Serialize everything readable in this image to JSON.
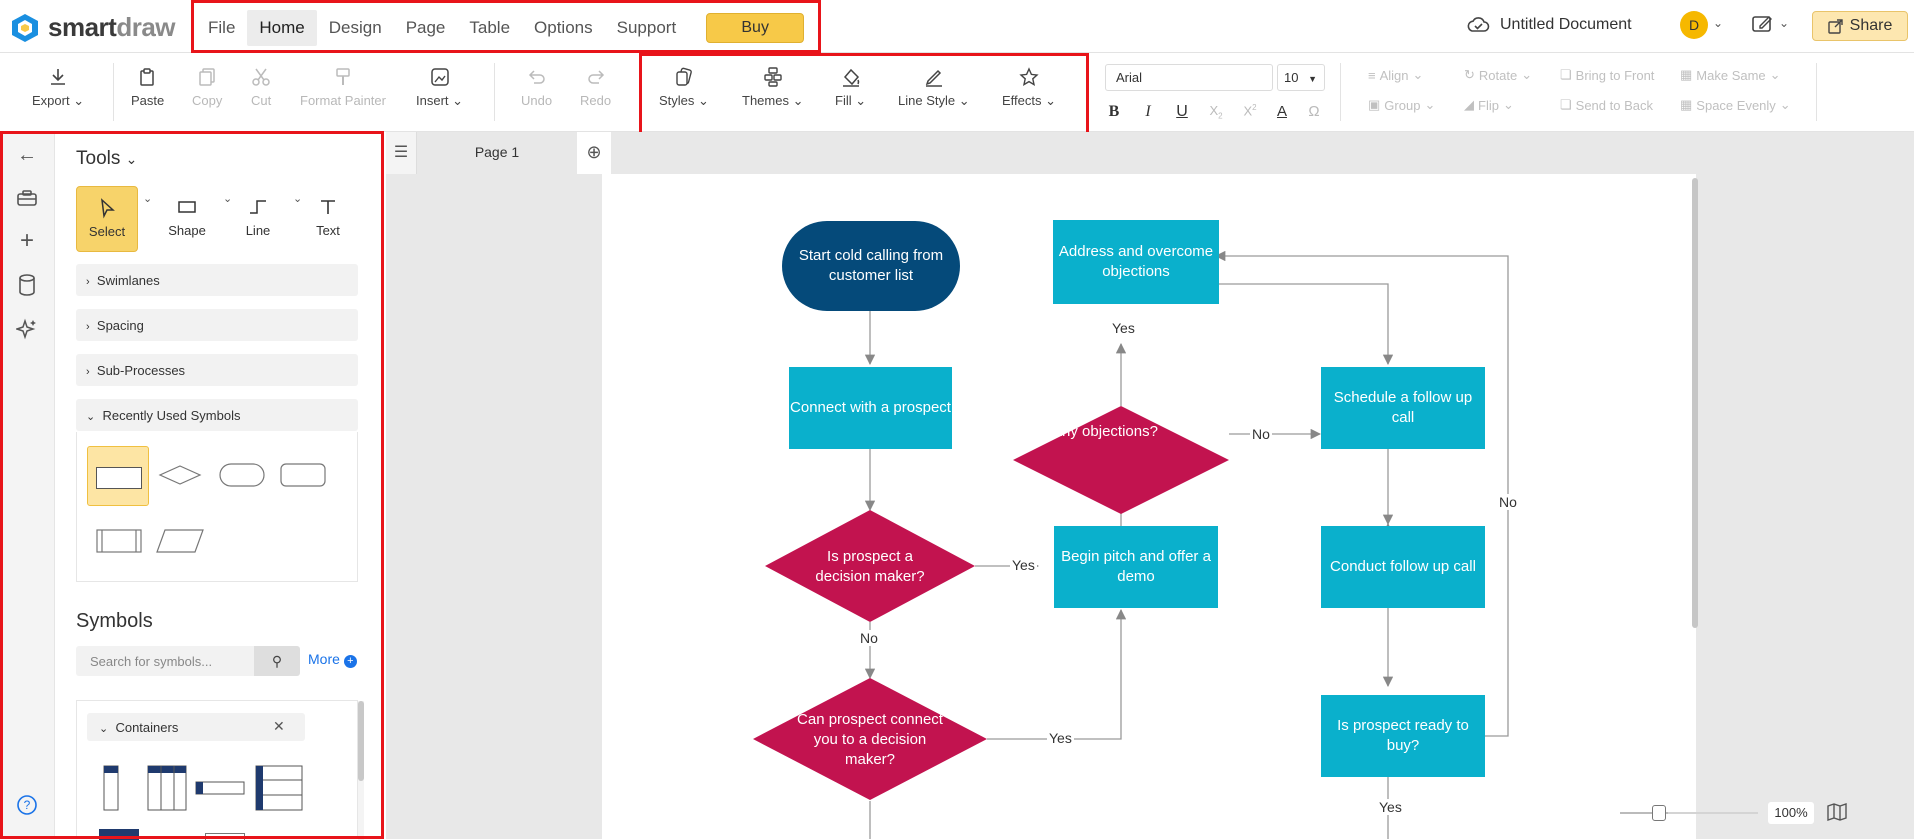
{
  "app": {
    "logo_main": "smart",
    "logo_accent": "draw"
  },
  "menu": [
    {
      "label": "File"
    },
    {
      "label": "Home"
    },
    {
      "label": "Design"
    },
    {
      "label": "Page"
    },
    {
      "label": "Table"
    },
    {
      "label": "Options"
    },
    {
      "label": "Support"
    }
  ],
  "buy_label": "Buy",
  "document_title": "Untitled Document",
  "user_initial": "D",
  "share_label": "Share",
  "toolbar": {
    "export": "Export",
    "paste": "Paste",
    "copy": "Copy",
    "cut": "Cut",
    "format_painter": "Format Painter",
    "insert": "Insert",
    "undo": "Undo",
    "redo": "Redo",
    "styles": "Styles",
    "themes": "Themes",
    "fill": "Fill",
    "line_style": "Line Style",
    "effects": "Effects",
    "font_family": "Arial",
    "font_size": "10",
    "align": "Align",
    "rotate": "Rotate",
    "bring_to_front": "Bring to Front",
    "make_same": "Make Same",
    "group": "Group",
    "flip": "Flip",
    "send_to_back": "Send to Back",
    "space_evenly": "Space Evenly"
  },
  "panel": {
    "title": "Tools",
    "tools": [
      {
        "label": "Select"
      },
      {
        "label": "Shape"
      },
      {
        "label": "Line"
      },
      {
        "label": "Text"
      }
    ],
    "sections": [
      {
        "label": "Swimlanes"
      },
      {
        "label": "Spacing"
      },
      {
        "label": "Sub-Processes"
      },
      {
        "label": "Recently Used Symbols"
      }
    ],
    "symbols_title": "Symbols",
    "search_placeholder": "Search for symbols...",
    "more_label": "More",
    "containers_label": "Containers"
  },
  "page_tab": "Page 1",
  "zoom": "100%",
  "diagram": {
    "start": "Start cold calling from customer list",
    "connect": "Connect with a prospect",
    "is_decision_maker": "Is prospect a decision maker?",
    "can_connect": "Can prospect connect you to a decision maker?",
    "begin_pitch": "Begin pitch and offer a demo",
    "any_objections": "Any objections?",
    "address_objections": "Address and overcome objections",
    "schedule_follow": "Schedule a follow up call",
    "conduct_follow": "Conduct follow up call",
    "ready_to_buy": "Is prospect ready to buy?",
    "yes": "Yes",
    "no": "No"
  },
  "colors": {
    "teal": "#0ab0cc",
    "crimson": "#c2134f",
    "navy": "#054a7a",
    "accent": "#f7c948",
    "highlight": "#e8141a"
  }
}
